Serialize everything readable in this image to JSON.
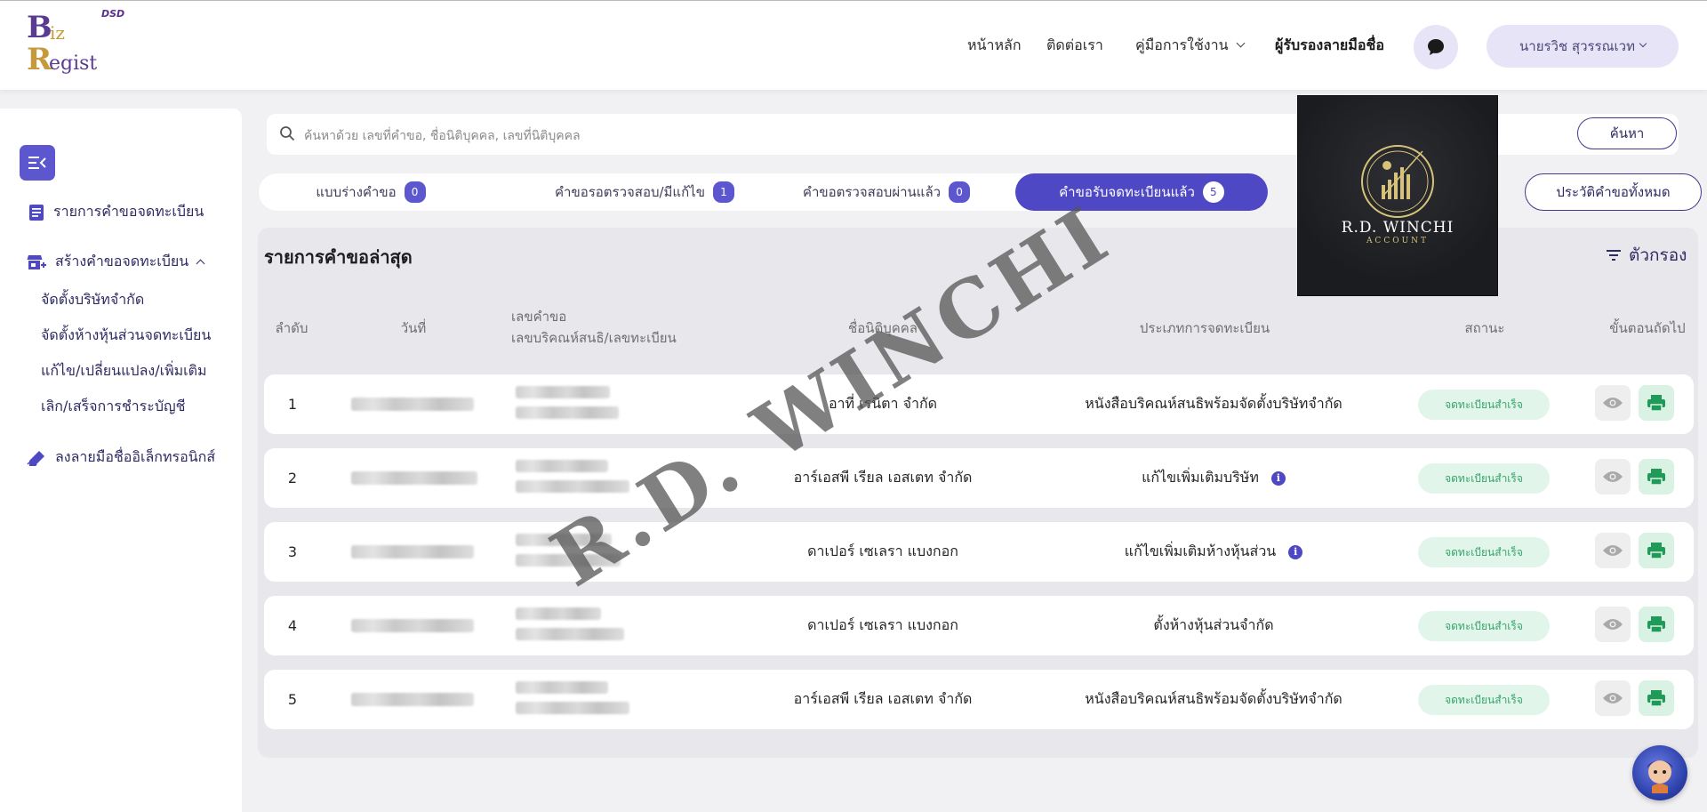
{
  "logo": {
    "brand_top": "DSD",
    "line1_big": "B",
    "line1_small": "iz",
    "line2_big": "R",
    "line2_small": "egist"
  },
  "header": {
    "nav": [
      "หน้าหลัก",
      "ติดต่อเรา",
      "คู่มือการใช้งาน",
      "ผู้รับรองลายมือชื่อ"
    ],
    "user_name": "นายรวิช สุวรรณเวท"
  },
  "sidebar": {
    "item_list": "รายการคำขอจดทะเบียน",
    "item_create": "สร้างคำขอจดทะเบียน",
    "sub_items": [
      "จัดตั้งบริษัทจำกัด",
      "จัดตั้งห้างหุ้นส่วนจดทะเบียน",
      "แก้ไข/เปลี่ยนแปลง/เพิ่มเติม",
      "เลิก/เสร็จการชำระบัญชี"
    ],
    "item_esign": "ลงลายมือชื่ออิเล็กทรอนิกส์"
  },
  "search": {
    "placeholder": "ค้นหาด้วย เลขที่คำขอ, ชื่อนิติบุคคล, เลขที่นิติบุคคล",
    "button": "ค้นหา"
  },
  "tabs": [
    {
      "label": "แบบร่างคำขอ",
      "count": "0"
    },
    {
      "label": "คำขอรอตรวจสอบ/มีแก้ไข",
      "count": "1"
    },
    {
      "label": "คำขอตรวจสอบผ่านแล้ว",
      "count": "0"
    },
    {
      "label": "คำขอรับจดทะเบียนแล้ว",
      "count": "5"
    }
  ],
  "history_button": "ประวัติคำขอทั้งหมด",
  "panel": {
    "title": "รายการคำขอล่าสุด",
    "filter": "ตัวกรอง"
  },
  "table": {
    "headers": {
      "order": "ลำดับ",
      "date": "วันที่",
      "req_no_1": "เลขคำขอ",
      "req_no_2": "เลขบริคณห์สนธิ/เลขทะเบียน",
      "entity": "ชื่อนิติบุคคล",
      "type": "ประเภทการจดทะเบียน",
      "status": "สถานะ",
      "next": "ขั้นตอนถัดไป"
    },
    "rows": [
      {
        "order": "1",
        "entity": "อาที่ เรนิตา จำกัด",
        "type": "หนังสือบริคณห์สนธิพร้อมจัดตั้งบริษัทจำกัด",
        "info": false,
        "status": "จดทะเบียนสำเร็จ"
      },
      {
        "order": "2",
        "entity": "อาร์เอสพี เรียล เอสเตท จำกัด",
        "type": "แก้ไขเพิ่มเติมบริษัท",
        "info": true,
        "status": "จดทะเบียนสำเร็จ"
      },
      {
        "order": "3",
        "entity": "ดาเปอร์ เซเลรา แบงกอก",
        "type": "แก้ไขเพิ่มเติมห้างหุ้นส่วน",
        "info": true,
        "status": "จดทะเบียนสำเร็จ"
      },
      {
        "order": "4",
        "entity": "ดาเปอร์ เซเลรา แบงกอก",
        "type": "ตั้งห้างหุ้นส่วนจำกัด",
        "info": false,
        "status": "จดทะเบียนสำเร็จ"
      },
      {
        "order": "5",
        "entity": "อาร์เอสพี เรียล เอสเตท จำกัด",
        "type": "หนังสือบริคณห์สนธิพร้อมจัดตั้งบริษัทจำกัด",
        "info": false,
        "status": "จดทะเบียนสำเร็จ"
      }
    ]
  },
  "watermark": {
    "logo_name": "R.D. WINCHI",
    "logo_sub": "ACCOUNT",
    "text": "R.D. WINCHI"
  },
  "colors": {
    "primary": "#4e48c4",
    "success_bg": "#e1f5ea",
    "success_text": "#38a46b"
  }
}
